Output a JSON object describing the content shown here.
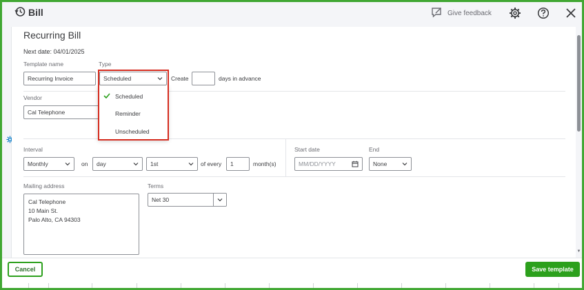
{
  "app": {
    "title": "Bill"
  },
  "topbar": {
    "feedback_label": "Give feedback"
  },
  "page": {
    "title": "Recurring Bill",
    "next_date": "Next date: 04/01/2025"
  },
  "template": {
    "name_label": "Template name",
    "name_value": "Recurring Invoice",
    "type_label": "Type",
    "type_value": "Scheduled",
    "create_label": "Create",
    "days_value": "",
    "days_suffix": "days in advance"
  },
  "type_options": [
    "Scheduled",
    "Reminder",
    "Unscheduled"
  ],
  "vendor": {
    "label": "Vendor",
    "value": "Cal Telephone"
  },
  "interval": {
    "label": "Interval",
    "frequency": "Monthly",
    "on_label": "on",
    "day_unit": "day",
    "day_value": "1st",
    "of_every_label": "of every",
    "months_value": "1",
    "months_suffix": "month(s)"
  },
  "schedule": {
    "start_label": "Start date",
    "start_placeholder": "MM/DD/YYYY",
    "end_label": "End",
    "end_value": "None"
  },
  "mailing": {
    "label": "Mailing address",
    "line1": "Cal Telephone",
    "line2": "10 Main St.",
    "line3": "Palo Alto, CA  94303"
  },
  "terms": {
    "label": "Terms",
    "value": "Net 30"
  },
  "footer": {
    "cancel_label": "Cancel",
    "save_label": "Save template"
  },
  "colors": {
    "accent": "#2ca01c",
    "highlight": "#d52b1e",
    "frame": "#41a733"
  }
}
